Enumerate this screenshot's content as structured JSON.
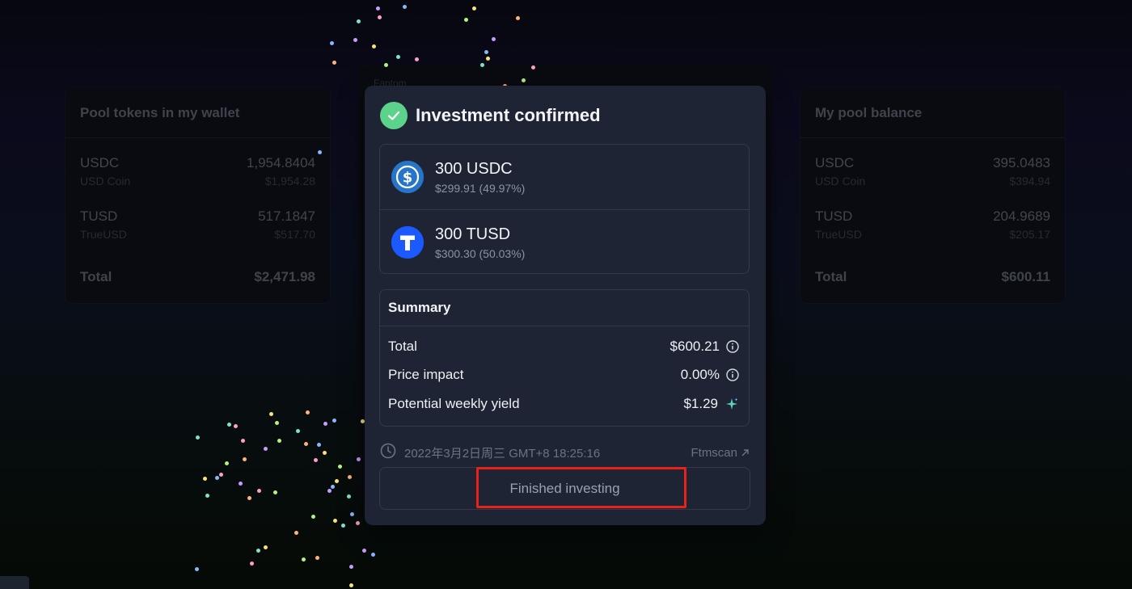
{
  "left_card": {
    "title": "Pool tokens in my wallet",
    "tokens": [
      {
        "symbol": "USDC",
        "name": "USD Coin",
        "balance": "1,954.8404",
        "usd": "$1,954.28"
      },
      {
        "symbol": "TUSD",
        "name": "TrueUSD",
        "balance": "517.1847",
        "usd": "$517.70"
      }
    ],
    "total_label": "Total",
    "total_value": "$2,471.98"
  },
  "right_card": {
    "title": "My pool balance",
    "tokens": [
      {
        "symbol": "USDC",
        "name": "USD Coin",
        "balance": "395.0483",
        "usd": "$394.94"
      },
      {
        "symbol": "TUSD",
        "name": "TrueUSD",
        "balance": "204.9689",
        "usd": "$205.17"
      }
    ],
    "total_label": "Total",
    "total_value": "$600.11"
  },
  "back_card": {
    "network": "Fantom"
  },
  "modal": {
    "title": "Investment confirmed",
    "tokens": [
      {
        "amount": "300 USDC",
        "value": "$299.91 (49.97%)",
        "icon": "usdc-icon",
        "color": "#2775ca"
      },
      {
        "amount": "300 TUSD",
        "value": "$300.30 (50.03%)",
        "icon": "tusd-icon",
        "color": "#1a5aff"
      }
    ],
    "summary": {
      "title": "Summary",
      "rows": [
        {
          "label": "Total",
          "value": "$600.21",
          "icon": "info-icon"
        },
        {
          "label": "Price impact",
          "value": "0.00%",
          "icon": "info-icon"
        },
        {
          "label": "Potential weekly yield",
          "value": "$1.29",
          "icon": "sparkle-icon"
        }
      ]
    },
    "timestamp": "2022年3月2日周三 GMT+8 18:25:16",
    "explorer_link": "Ftmscan",
    "finish_button": "Finished investing"
  },
  "colors": {
    "accent_green": "#5cd38a",
    "highlight_red": "#e8221b",
    "modal_bg": "#1e2433"
  }
}
